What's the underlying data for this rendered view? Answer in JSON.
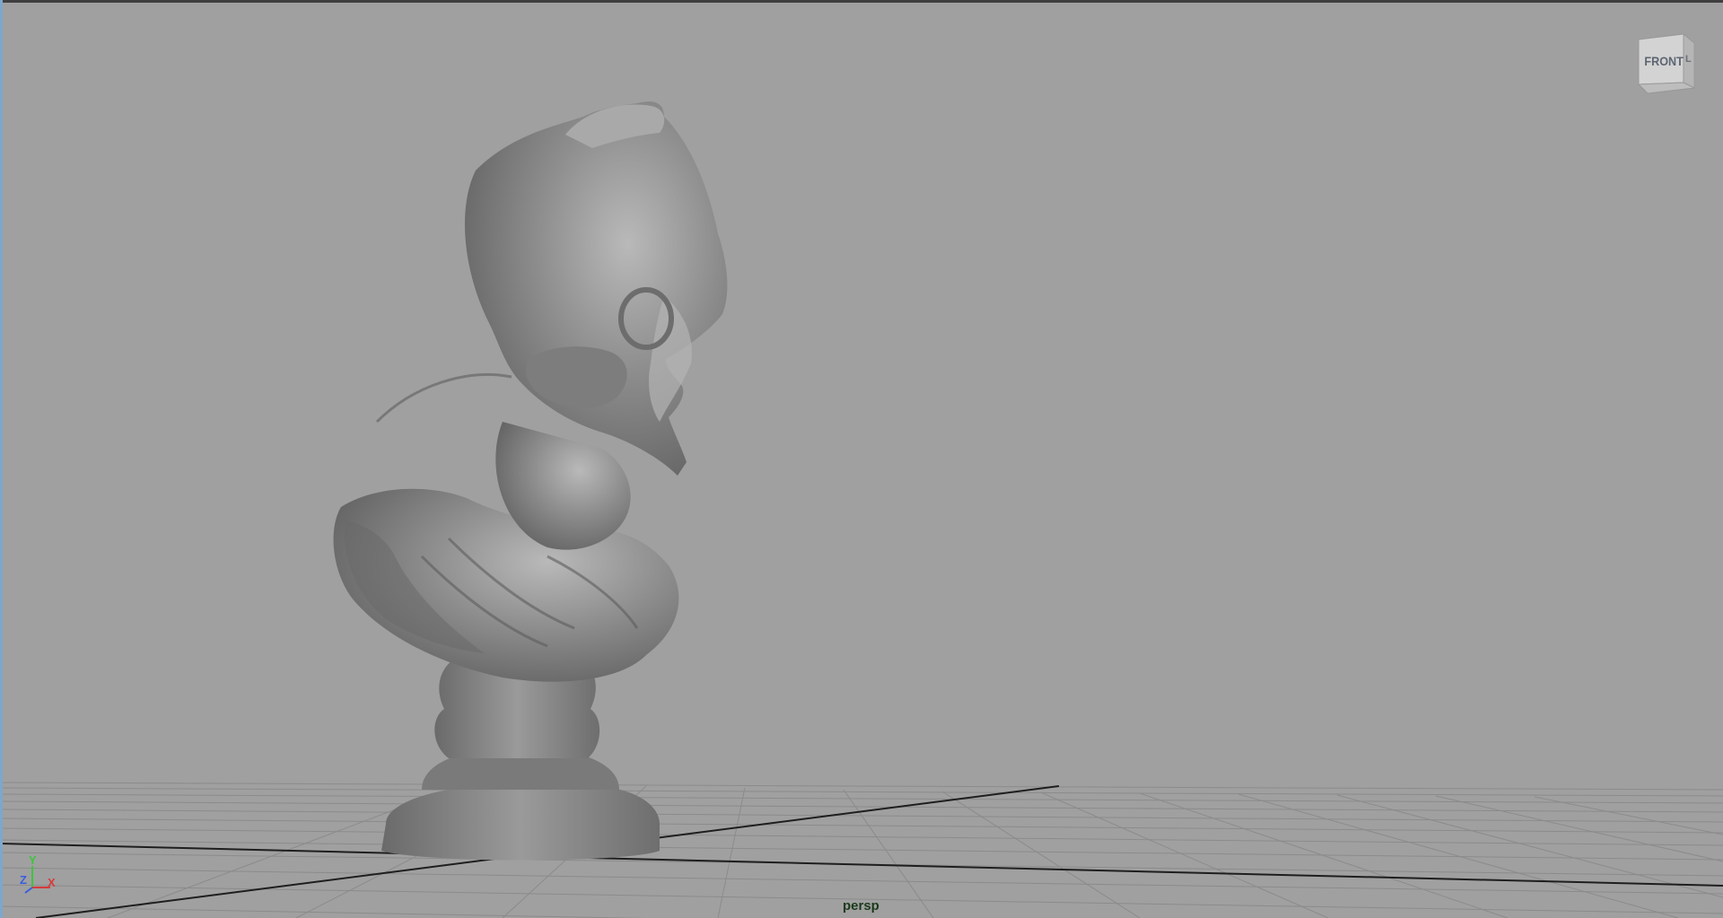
{
  "viewport": {
    "camera_name": "persp"
  },
  "view_cube": {
    "face_label": "FRONT",
    "side_label": "L"
  },
  "axis_gizmo": {
    "y_label": "Y",
    "z_label": "Z",
    "x_label": "X",
    "y_color": "#3ec43e",
    "z_color": "#3a5de0",
    "x_color": "#d83a3a"
  },
  "colors": {
    "background": "#a0a0a0",
    "grid_line": "#8c8c8c",
    "grid_axis": "#1f1f1f",
    "model": "#858585"
  },
  "model": {
    "name": "sculpture-bust"
  }
}
